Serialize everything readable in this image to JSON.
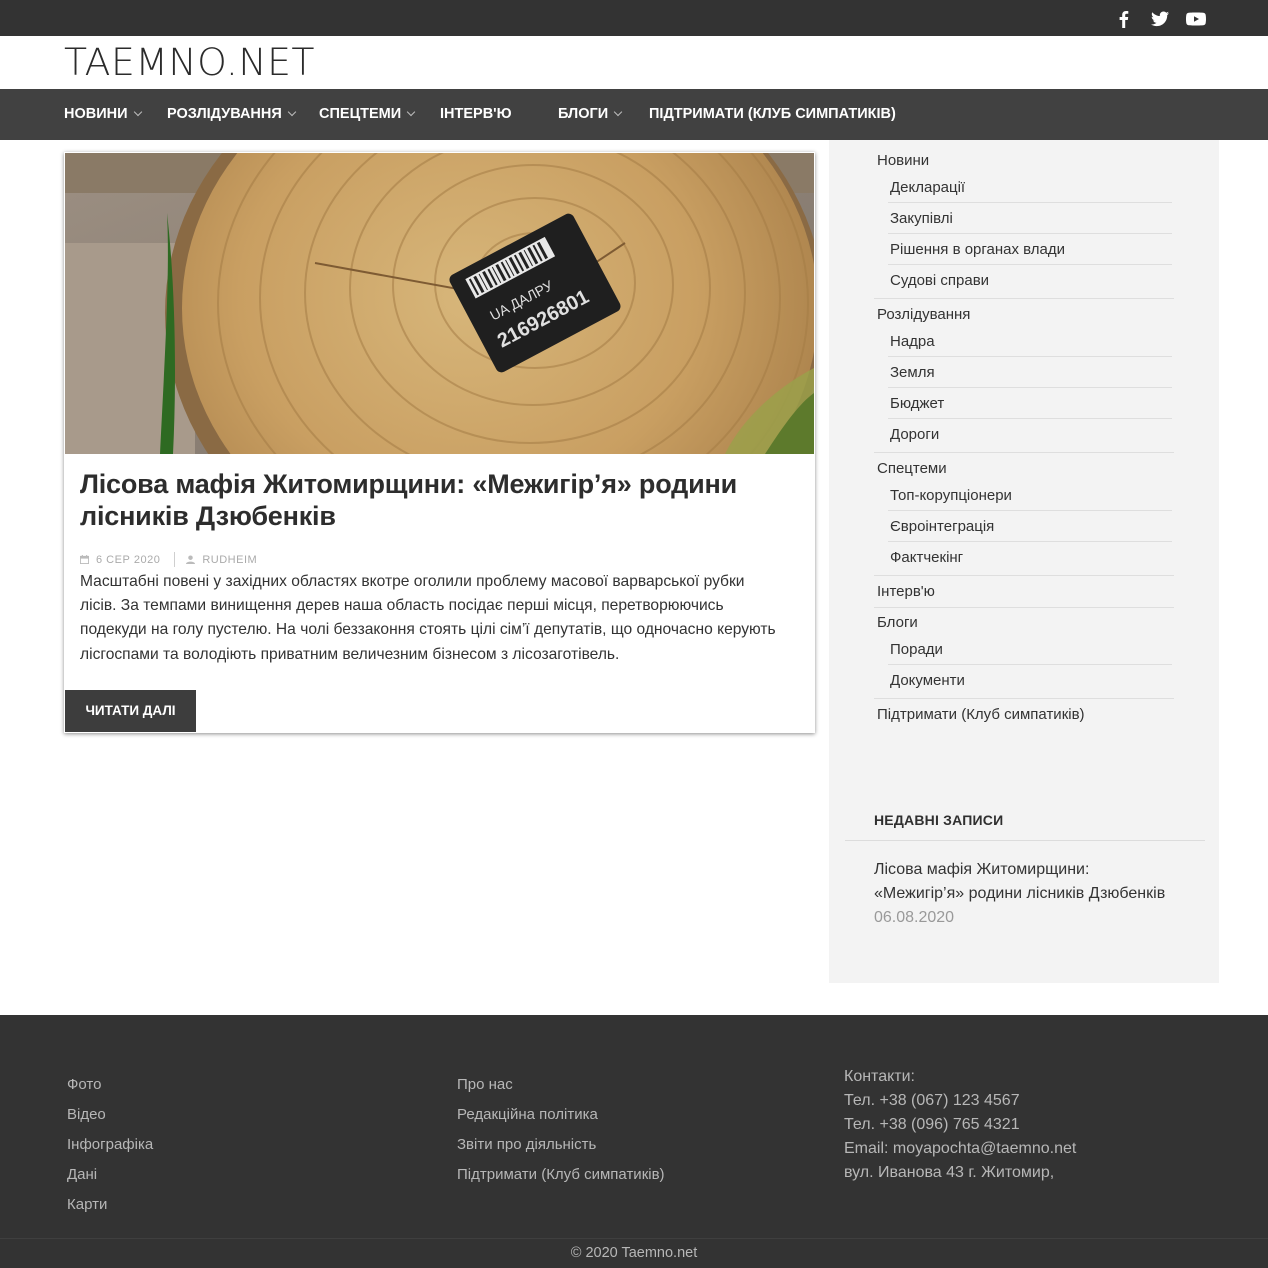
{
  "site": {
    "logo": "TAEMNO.NET"
  },
  "social": [
    {
      "name": "facebook-icon"
    },
    {
      "name": "twitter-icon"
    },
    {
      "name": "youtube-icon"
    }
  ],
  "nav": {
    "items": [
      {
        "label": "Новини",
        "dropdown": true
      },
      {
        "label": "Розлідування",
        "dropdown": true
      },
      {
        "label": "Спецтеми",
        "dropdown": true
      },
      {
        "label": "Інтерв'ю",
        "dropdown": false
      },
      {
        "label": "Блоги",
        "dropdown": true
      },
      {
        "label": "Підтримати (Клуб симпатиків)",
        "dropdown": false
      }
    ]
  },
  "article": {
    "title": "Лісова мафія Житомирщини: «Межигір’я» родини лісників Дзюбенків",
    "date": "6 сер 2020",
    "author": "rudheim",
    "tag_text": "UA ДАЛРУ",
    "tag_number": "216926801",
    "excerpt": "Масштабні повені у західних областях вкотре оголили проблему масової варварської рубки лісів. За темпами винищення дерев наша область посідає перші місця, перетворюючись подекуди на голу пустелю. На чолі беззаконня стоять цілі сім’ї депутатів, що одночасно керують лісгоспами та володіють приватним величезним бізнесом з лісозаготівель.",
    "read_more": "Читати далі"
  },
  "sidebar": {
    "categories": [
      {
        "label": "Новини",
        "children": [
          "Декларації",
          "Закупівлі",
          "Рішення в органах влади",
          "Судові справи"
        ]
      },
      {
        "label": "Розлідування",
        "children": [
          "Надра",
          "Земля",
          "Бюджет",
          "Дороги"
        ]
      },
      {
        "label": "Спецтеми",
        "children": [
          "Топ-корупціонери",
          "Євроінтеграція",
          "Фактчекінг"
        ]
      },
      {
        "label": "Інтерв'ю",
        "children": []
      },
      {
        "label": "Блоги",
        "children": [
          "Поради",
          "Документи"
        ]
      },
      {
        "label": "Підтримати (Клуб симпатиків)",
        "children": []
      }
    ],
    "recent_title": "Недавні записи",
    "recent_post_title": "Лісова мафія Житомирщини: «Межигір’я» родини лісників Дзюбенків",
    "recent_post_date": "06.08.2020"
  },
  "footer": {
    "col1": [
      "Фото",
      "Відео",
      "Інфографіка",
      "Дані",
      "Карти"
    ],
    "col2": [
      "Про нас",
      "Редакційна політика",
      "Звіти про діяльність",
      "Підтримати (Клуб симпатиків)"
    ],
    "contacts": [
      "Контакти:",
      "Тел. +38 (067) 123 4567",
      "Тел. +38 (096) 765 4321",
      "Email: moyapochta@taemno.net",
      "вул. Иванова 43 г. Житомир,"
    ],
    "copyright": "© 2020 Taemno.net"
  }
}
